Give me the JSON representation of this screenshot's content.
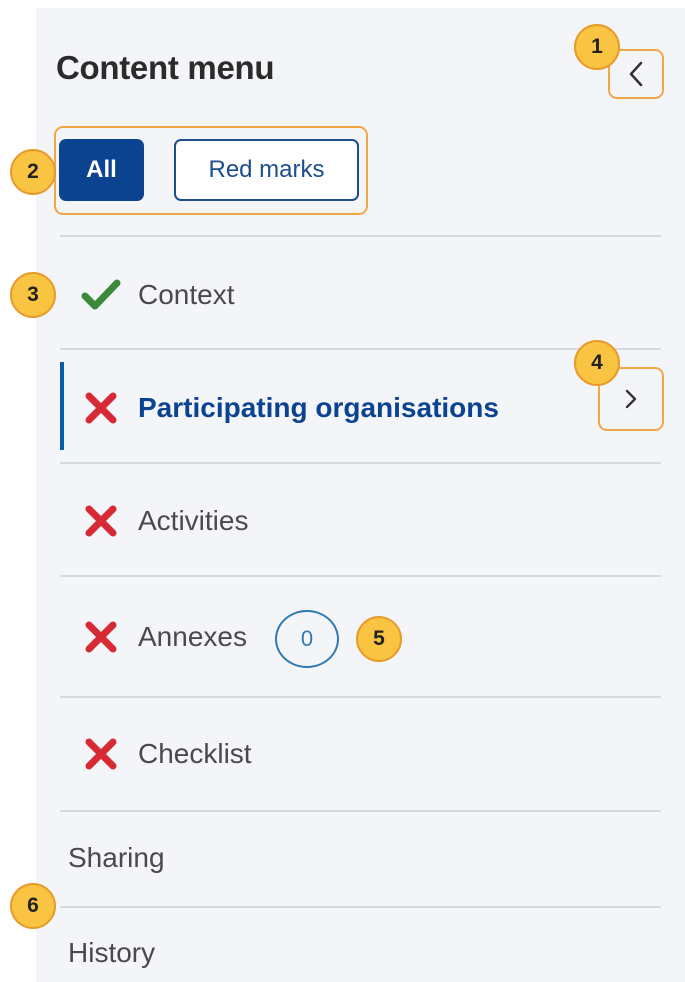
{
  "header": {
    "title": "Content menu"
  },
  "filters": {
    "all_label": "All",
    "red_marks_label": "Red marks"
  },
  "menu": {
    "items": [
      {
        "label": "Context",
        "status": "complete",
        "icon": "check-icon"
      },
      {
        "label": "Participating organisations",
        "status": "incomplete",
        "icon": "cross-icon",
        "active": true
      },
      {
        "label": "Activities",
        "status": "incomplete",
        "icon": "cross-icon"
      },
      {
        "label": "Annexes",
        "status": "incomplete",
        "icon": "cross-icon",
        "count": "0"
      },
      {
        "label": "Checklist",
        "status": "incomplete",
        "icon": "cross-icon"
      }
    ]
  },
  "links": {
    "sharing": "Sharing",
    "history": "History"
  },
  "callouts": [
    "1",
    "2",
    "3",
    "4",
    "5",
    "6"
  ],
  "colors": {
    "accent": "#0b4390",
    "success": "#3a8a3a",
    "error": "#d62b34",
    "highlight": "#f0a846",
    "callout_fill": "#f9c441"
  }
}
